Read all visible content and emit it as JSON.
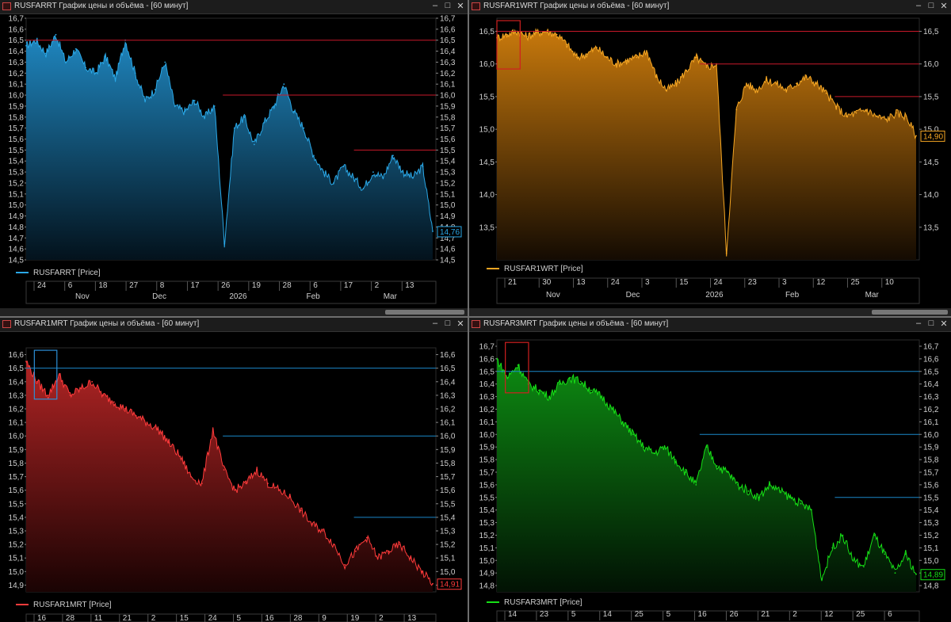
{
  "panels": [
    {
      "id": "p1",
      "title": "RUSFARRT График цены и объёма - [60 минут]",
      "color": "#2aa7e6",
      "fill_top": "#1f86bf",
      "fill_bottom": "#03121c",
      "hline_color": "#c8192a",
      "legend": "RUSFARRT [Price]",
      "last_value": "14,76",
      "y_ticks": [
        "16,7",
        "16,6",
        "16,5",
        "16,4",
        "16,3",
        "16,2",
        "16,1",
        "16,0",
        "15,9",
        "15,8",
        "15,7",
        "15,6",
        "15,5",
        "15,4",
        "15,3",
        "15,2",
        "15,1",
        "15,0",
        "14,9",
        "14,8",
        "14,7",
        "14,6",
        "14,5"
      ],
      "x_days": [
        "24",
        "6",
        "18",
        "27",
        "8",
        "17",
        "26",
        "19",
        "28",
        "6",
        "17",
        "2",
        "13"
      ],
      "x_months": [
        "Nov",
        "Dec",
        "2026",
        "Feb",
        "Mar"
      ],
      "hlines": [
        16.5,
        16.0,
        15.5
      ],
      "box": null
    },
    {
      "id": "p2",
      "title": "RUSFAR1WRT График цены и объёма - [60 минут]",
      "color": "#f5a623",
      "fill_top": "#c8790c",
      "fill_bottom": "#140b02",
      "hline_color": "#c8192a",
      "legend": "RUSFAR1WRT [Price]",
      "last_value": "14,90",
      "y_ticks": [
        "16,5",
        "16,0",
        "15,5",
        "15,0",
        "14,5",
        "14,0",
        "13,5"
      ],
      "x_days": [
        "21",
        "30",
        "13",
        "24",
        "3",
        "15",
        "24",
        "23",
        "3",
        "12",
        "25",
        "10"
      ],
      "x_months": [
        "Nov",
        "Dec",
        "2026",
        "Feb",
        "Mar"
      ],
      "hlines": [
        16.5,
        16.0,
        15.5
      ],
      "box": "red"
    },
    {
      "id": "p3",
      "title": "RUSFAR1MRT График цены и объёма - [60 минут]",
      "color": "#ff3b3b",
      "fill_top": "#b02424",
      "fill_bottom": "#1a0303",
      "hline_color": "#1b87c9",
      "legend": "RUSFAR1MRT [Price]",
      "last_value": "14,91",
      "y_ticks": [
        "16,6",
        "16,5",
        "16,4",
        "16,3",
        "16,2",
        "16,1",
        "16,0",
        "15,9",
        "15,8",
        "15,7",
        "15,6",
        "15,5",
        "15,4",
        "15,3",
        "15,2",
        "15,1",
        "15,0",
        "14,9"
      ],
      "x_days": [
        "16",
        "28",
        "11",
        "21",
        "2",
        "15",
        "24",
        "5",
        "16",
        "28",
        "9",
        "19",
        "2",
        "13"
      ],
      "x_months": [
        "Nov",
        "Dec",
        "2026",
        "Feb",
        "Mar"
      ],
      "hlines": [
        16.5,
        16.0,
        15.4
      ],
      "box": "blue"
    },
    {
      "id": "p4",
      "title": "RUSFAR3MRT График цены и объёма - [60 минут]",
      "color": "#16e016",
      "fill_top": "#0d8c12",
      "fill_bottom": "#021204",
      "hline_color": "#1b87c9",
      "legend": "RUSFAR3MRT [Price]",
      "last_value": "14,89",
      "y_ticks": [
        "16,7",
        "16,6",
        "16,5",
        "16,4",
        "16,3",
        "16,2",
        "16,1",
        "16,0",
        "15,9",
        "15,8",
        "15,7",
        "15,6",
        "15,5",
        "15,4",
        "15,3",
        "15,2",
        "15,1",
        "15,0",
        "14,9",
        "14,8"
      ],
      "x_days": [
        "14",
        "23",
        "5",
        "14",
        "25",
        "5",
        "16",
        "26",
        "21",
        "2",
        "12",
        "25",
        "6"
      ],
      "x_months": [
        "Nov",
        "Dec",
        "2026",
        "Feb",
        "Mar"
      ],
      "hlines": [
        16.5,
        16.0,
        15.5
      ],
      "box": "red"
    }
  ],
  "chart_data": [
    {
      "type": "area",
      "title": "RUSFARRT График цены и объёма - [60 минут]",
      "series": [
        {
          "name": "RUSFARRT [Price]",
          "values": [
            16.45,
            16.5,
            16.38,
            16.55,
            16.3,
            16.42,
            16.25,
            16.2,
            16.35,
            16.15,
            16.5,
            16.2,
            15.95,
            16.05,
            16.3,
            15.9,
            15.85,
            15.95,
            15.8,
            15.9,
            14.65,
            15.7,
            15.8,
            15.55,
            15.75,
            15.9,
            16.1,
            15.85,
            15.7,
            15.45,
            15.3,
            15.2,
            15.35,
            15.25,
            15.15,
            15.3,
            15.25,
            15.45,
            15.3,
            15.25,
            15.35,
            14.76
          ]
        }
      ],
      "ylim": [
        14.5,
        16.7
      ],
      "hlines": [
        16.5,
        16.0,
        15.5
      ],
      "last": 14.76
    },
    {
      "type": "area",
      "title": "RUSFAR1WRT График цены и объёма - [60 минут]",
      "series": [
        {
          "name": "RUSFAR1WRT [Price]",
          "values": [
            16.4,
            16.45,
            16.5,
            16.42,
            16.48,
            16.5,
            16.45,
            16.3,
            16.1,
            16.15,
            16.25,
            16.1,
            16.0,
            16.05,
            16.1,
            16.2,
            15.8,
            15.6,
            15.7,
            15.9,
            16.1,
            15.95,
            16.0,
            13.1,
            15.3,
            15.7,
            15.6,
            15.75,
            15.7,
            15.6,
            15.7,
            15.8,
            15.7,
            15.55,
            15.35,
            15.2,
            15.25,
            15.3,
            15.2,
            15.15,
            15.25,
            15.2,
            14.9
          ]
        }
      ],
      "ylim": [
        13.0,
        16.7
      ],
      "hlines": [
        16.5,
        16.0,
        15.5
      ],
      "last": 14.9
    },
    {
      "type": "area",
      "title": "RUSFAR1MRT График цены и объёма - [60 минут]",
      "series": [
        {
          "name": "RUSFAR1MRT [Price]",
          "values": [
            16.55,
            16.4,
            16.3,
            16.45,
            16.3,
            16.35,
            16.4,
            16.3,
            16.25,
            16.2,
            16.15,
            16.1,
            16.05,
            15.95,
            15.85,
            15.7,
            15.65,
            16.05,
            15.75,
            15.6,
            15.65,
            15.75,
            15.65,
            15.6,
            15.55,
            15.45,
            15.35,
            15.3,
            15.2,
            15.05,
            15.15,
            15.25,
            15.1,
            15.15,
            15.2,
            15.1,
            15.0,
            14.91
          ]
        }
      ],
      "ylim": [
        14.85,
        16.65
      ],
      "hlines": [
        16.5,
        16.0,
        15.4
      ],
      "last": 14.91
    },
    {
      "type": "area",
      "title": "RUSFAR3MRT График цены и объёма - [60 минут]",
      "series": [
        {
          "name": "RUSFAR3MRT [Price]",
          "values": [
            16.6,
            16.45,
            16.55,
            16.4,
            16.35,
            16.3,
            16.4,
            16.45,
            16.42,
            16.35,
            16.3,
            16.2,
            16.1,
            16.0,
            15.9,
            15.85,
            15.9,
            15.8,
            15.7,
            15.6,
            15.9,
            15.75,
            15.7,
            15.6,
            15.55,
            15.5,
            15.6,
            15.55,
            15.5,
            15.45,
            15.4,
            14.85,
            15.1,
            15.2,
            15.0,
            14.95,
            15.2,
            15.05,
            14.9,
            15.05,
            14.89
          ]
        }
      ],
      "ylim": [
        14.75,
        16.75
      ],
      "hlines": [
        16.5,
        16.0,
        15.5
      ],
      "last": 14.89
    }
  ]
}
